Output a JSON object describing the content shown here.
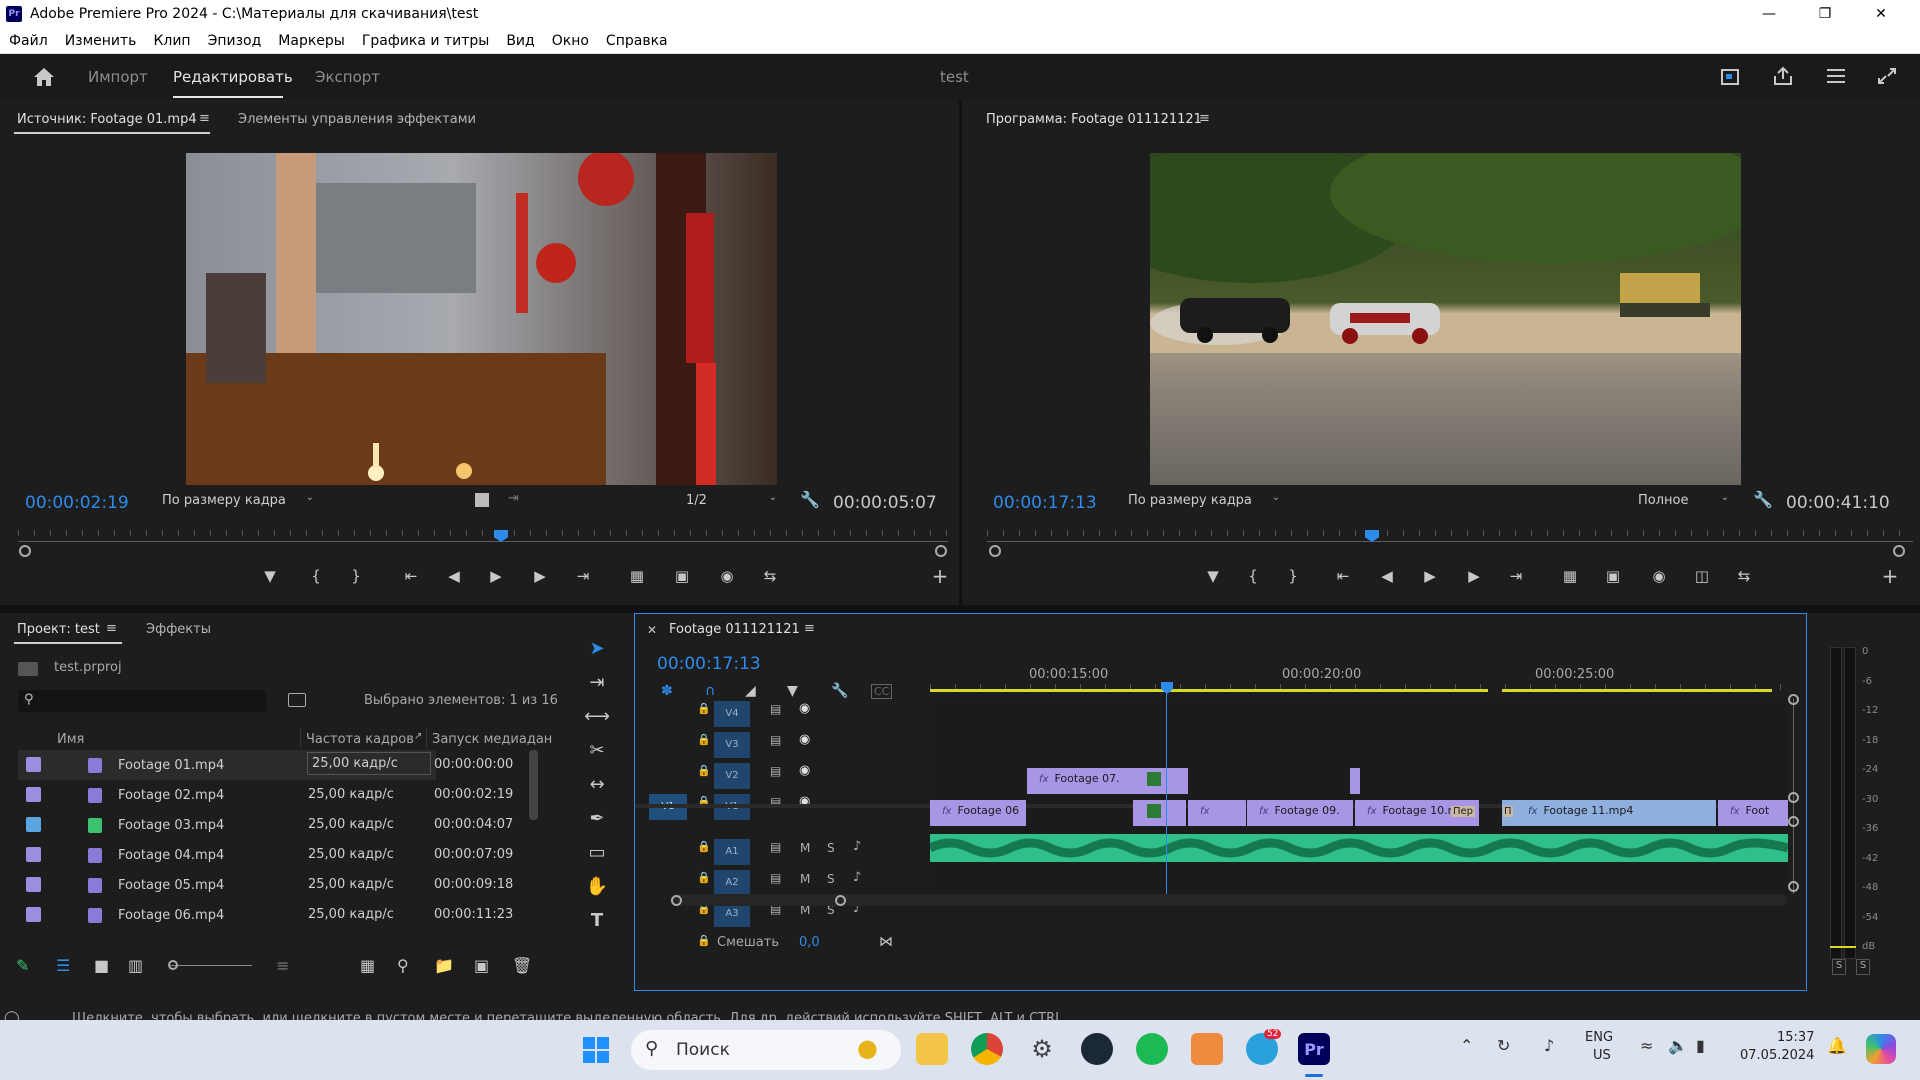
{
  "window": {
    "title": "Adobe Premiere Pro 2024 - C:\\Материалы для скачивания\\test",
    "app_icon": "Pr"
  },
  "menu": [
    "Файл",
    "Изменить",
    "Клип",
    "Эпизод",
    "Маркеры",
    "Графика и титры",
    "Вид",
    "Окно",
    "Справка"
  ],
  "header": {
    "tabs": [
      "Импорт",
      "Редактировать",
      "Экспорт"
    ],
    "active": "Редактировать",
    "project_name": "test"
  },
  "source": {
    "tab_label": "Источник: Footage 01.mp4",
    "effects_tab": "Элементы управления эффектами",
    "timecode": "00:00:02:19",
    "fit": "По размеру кадра",
    "quality": "1/2",
    "duration": "00:00:05:07",
    "playhead_position": 0.53
  },
  "program": {
    "tab_label": "Программа: Footage 011121121",
    "timecode": "00:00:17:13",
    "fit": "По размеру кадра",
    "quality": "Полное",
    "duration": "00:00:41:10",
    "playhead_position": 0.42
  },
  "project": {
    "tab_label": "Проект: test",
    "effects_tab": "Эффекты",
    "file": "test.prproj",
    "selected_info": "Выбрано элементов: 1 из 16",
    "columns": [
      "Имя",
      "Частота кадров",
      "Запуск медиадан"
    ],
    "items": [
      {
        "name": "Footage 01.mp4",
        "fps": "25,00 кадр/с",
        "start": "00:00:00:00",
        "color": "#9b8ee0"
      },
      {
        "name": "Footage 02.mp4",
        "fps": "25,00 кадр/с",
        "start": "00:00:02:19",
        "color": "#9b8ee0"
      },
      {
        "name": "Footage 03.mp4",
        "fps": "25,00 кадр/с",
        "start": "00:00:04:07",
        "color": "#5ba6e0"
      },
      {
        "name": "Footage 04.mp4",
        "fps": "25,00 кадр/с",
        "start": "00:00:07:09",
        "color": "#9b8ee0"
      },
      {
        "name": "Footage 05.mp4",
        "fps": "25,00 кадр/с",
        "start": "00:00:09:18",
        "color": "#9b8ee0"
      },
      {
        "name": "Footage 06.mp4",
        "fps": "25,00 кадр/с",
        "start": "00:00:11:23",
        "color": "#9b8ee0"
      }
    ]
  },
  "timeline": {
    "sequence_name": "Footage 011121121",
    "timecode": "00:00:17:13",
    "ruler": [
      "00:00:15:00",
      "00:00:20:00",
      "00:00:25:00"
    ],
    "video_tracks": [
      "V4",
      "V3",
      "V2",
      "V1"
    ],
    "audio_tracks": [
      "A1",
      "A2",
      "A3"
    ],
    "target_label": "V1",
    "mix_label": "Смешать",
    "mix_value": "0,0",
    "audio_buttons": {
      "mute": "M",
      "solo": "S"
    },
    "clips": {
      "v2_a": "Footage 07.",
      "v1_a": "Footage 06",
      "v1_b": "Footage 09.",
      "v1_c": "Footage 10.m",
      "v1_c_trans": "Пер",
      "v1_d_trans": "П",
      "v1_e": "Footage 11.mp4",
      "v1_f": "Foot"
    },
    "fx_label": "fx"
  },
  "meters": {
    "labels": [
      "0",
      "-6",
      "-12",
      "-18",
      "-24",
      "-30",
      "-36",
      "-42",
      "-48",
      "-54",
      "dB"
    ],
    "solo": "S"
  },
  "status": {
    "text": "Щелкните, чтобы выбрать, или щелкните в пустом месте и перетащите выделенную область. Для др. действий используйте SHIFT, ALT и CTRL."
  },
  "taskbar": {
    "search_placeholder": "Поиск",
    "lang_top": "ENG",
    "lang_bottom": "US",
    "time": "15:37",
    "date": "07.05.2024",
    "telegram_badge": "52",
    "premiere_label": "Pr"
  },
  "colors": {
    "accent": "#2d8ceb",
    "video_clip": "#a895e6",
    "video_clip_alt": "#8fb0de",
    "audio_clip": "#2fc08a",
    "playhead": "#2d8ceb",
    "work_area": "#d9d92a"
  }
}
